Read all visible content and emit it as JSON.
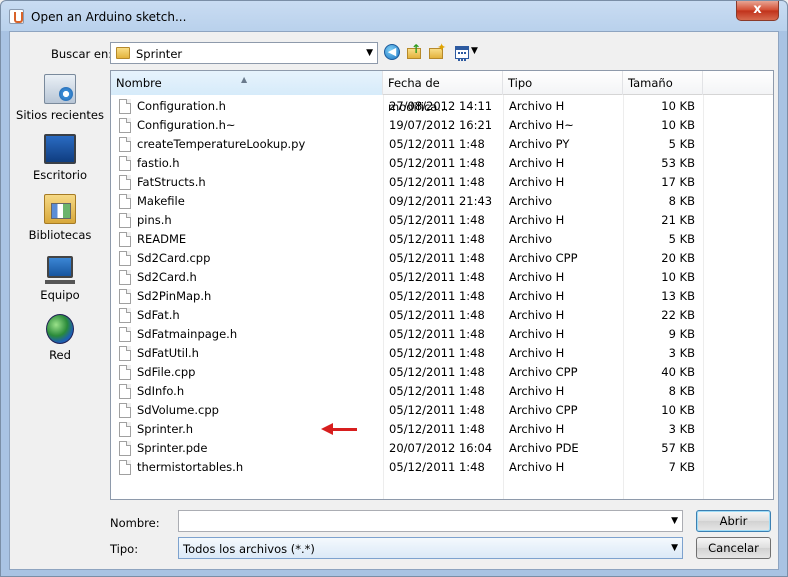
{
  "window": {
    "title": "Open an Arduino sketch...",
    "close_label": "x"
  },
  "lookin": {
    "label": "Buscar en:",
    "value": "Sprinter"
  },
  "places": [
    {
      "label": "Sitios recientes",
      "icon": "recent-places-icon"
    },
    {
      "label": "Escritorio",
      "icon": "desktop-icon"
    },
    {
      "label": "Bibliotecas",
      "icon": "libraries-icon"
    },
    {
      "label": "Equipo",
      "icon": "computer-icon"
    },
    {
      "label": "Red",
      "icon": "network-icon"
    }
  ],
  "columns": {
    "name": "Nombre",
    "date": "Fecha de modifica...",
    "type": "Tipo",
    "size": "Tamaño"
  },
  "files": [
    {
      "name": "Configuration.h",
      "date": "27/08/2012 14:11",
      "type": "Archivo H",
      "size": "10 KB"
    },
    {
      "name": "Configuration.h~",
      "date": "19/07/2012 16:21",
      "type": "Archivo H~",
      "size": "10 KB"
    },
    {
      "name": "createTemperatureLookup.py",
      "date": "05/12/2011 1:48",
      "type": "Archivo PY",
      "size": "5 KB"
    },
    {
      "name": "fastio.h",
      "date": "05/12/2011 1:48",
      "type": "Archivo H",
      "size": "53 KB"
    },
    {
      "name": "FatStructs.h",
      "date": "05/12/2011 1:48",
      "type": "Archivo H",
      "size": "17 KB"
    },
    {
      "name": "Makefile",
      "date": "09/12/2011 21:43",
      "type": "Archivo",
      "size": "8 KB"
    },
    {
      "name": "pins.h",
      "date": "05/12/2011 1:48",
      "type": "Archivo H",
      "size": "21 KB"
    },
    {
      "name": "README",
      "date": "05/12/2011 1:48",
      "type": "Archivo",
      "size": "5 KB"
    },
    {
      "name": "Sd2Card.cpp",
      "date": "05/12/2011 1:48",
      "type": "Archivo CPP",
      "size": "20 KB"
    },
    {
      "name": "Sd2Card.h",
      "date": "05/12/2011 1:48",
      "type": "Archivo H",
      "size": "10 KB"
    },
    {
      "name": "Sd2PinMap.h",
      "date": "05/12/2011 1:48",
      "type": "Archivo H",
      "size": "13 KB"
    },
    {
      "name": "SdFat.h",
      "date": "05/12/2011 1:48",
      "type": "Archivo H",
      "size": "22 KB"
    },
    {
      "name": "SdFatmainpage.h",
      "date": "05/12/2011 1:48",
      "type": "Archivo H",
      "size": "9 KB"
    },
    {
      "name": "SdFatUtil.h",
      "date": "05/12/2011 1:48",
      "type": "Archivo H",
      "size": "3 KB"
    },
    {
      "name": "SdFile.cpp",
      "date": "05/12/2011 1:48",
      "type": "Archivo CPP",
      "size": "40 KB"
    },
    {
      "name": "SdInfo.h",
      "date": "05/12/2011 1:48",
      "type": "Archivo H",
      "size": "8 KB"
    },
    {
      "name": "SdVolume.cpp",
      "date": "05/12/2011 1:48",
      "type": "Archivo CPP",
      "size": "10 KB"
    },
    {
      "name": "Sprinter.h",
      "date": "05/12/2011 1:48",
      "type": "Archivo H",
      "size": "3 KB",
      "highlight_arrow": true
    },
    {
      "name": "Sprinter.pde",
      "date": "20/07/2012 16:04",
      "type": "Archivo PDE",
      "size": "57 KB"
    },
    {
      "name": "thermistortables.h",
      "date": "05/12/2011 1:48",
      "type": "Archivo H",
      "size": "7 KB"
    }
  ],
  "filename": {
    "label": "Nombre:",
    "value": "",
    "placeholder": ""
  },
  "filetype": {
    "label": "Tipo:",
    "value": "Todos los archivos (*.*)"
  },
  "buttons": {
    "open": "Abrir",
    "cancel": "Cancelar"
  },
  "colors": {
    "annotation_arrow": "#d71e1e",
    "title_gradient_top": "#c9dcf2",
    "close_button": "#d24a2f"
  }
}
